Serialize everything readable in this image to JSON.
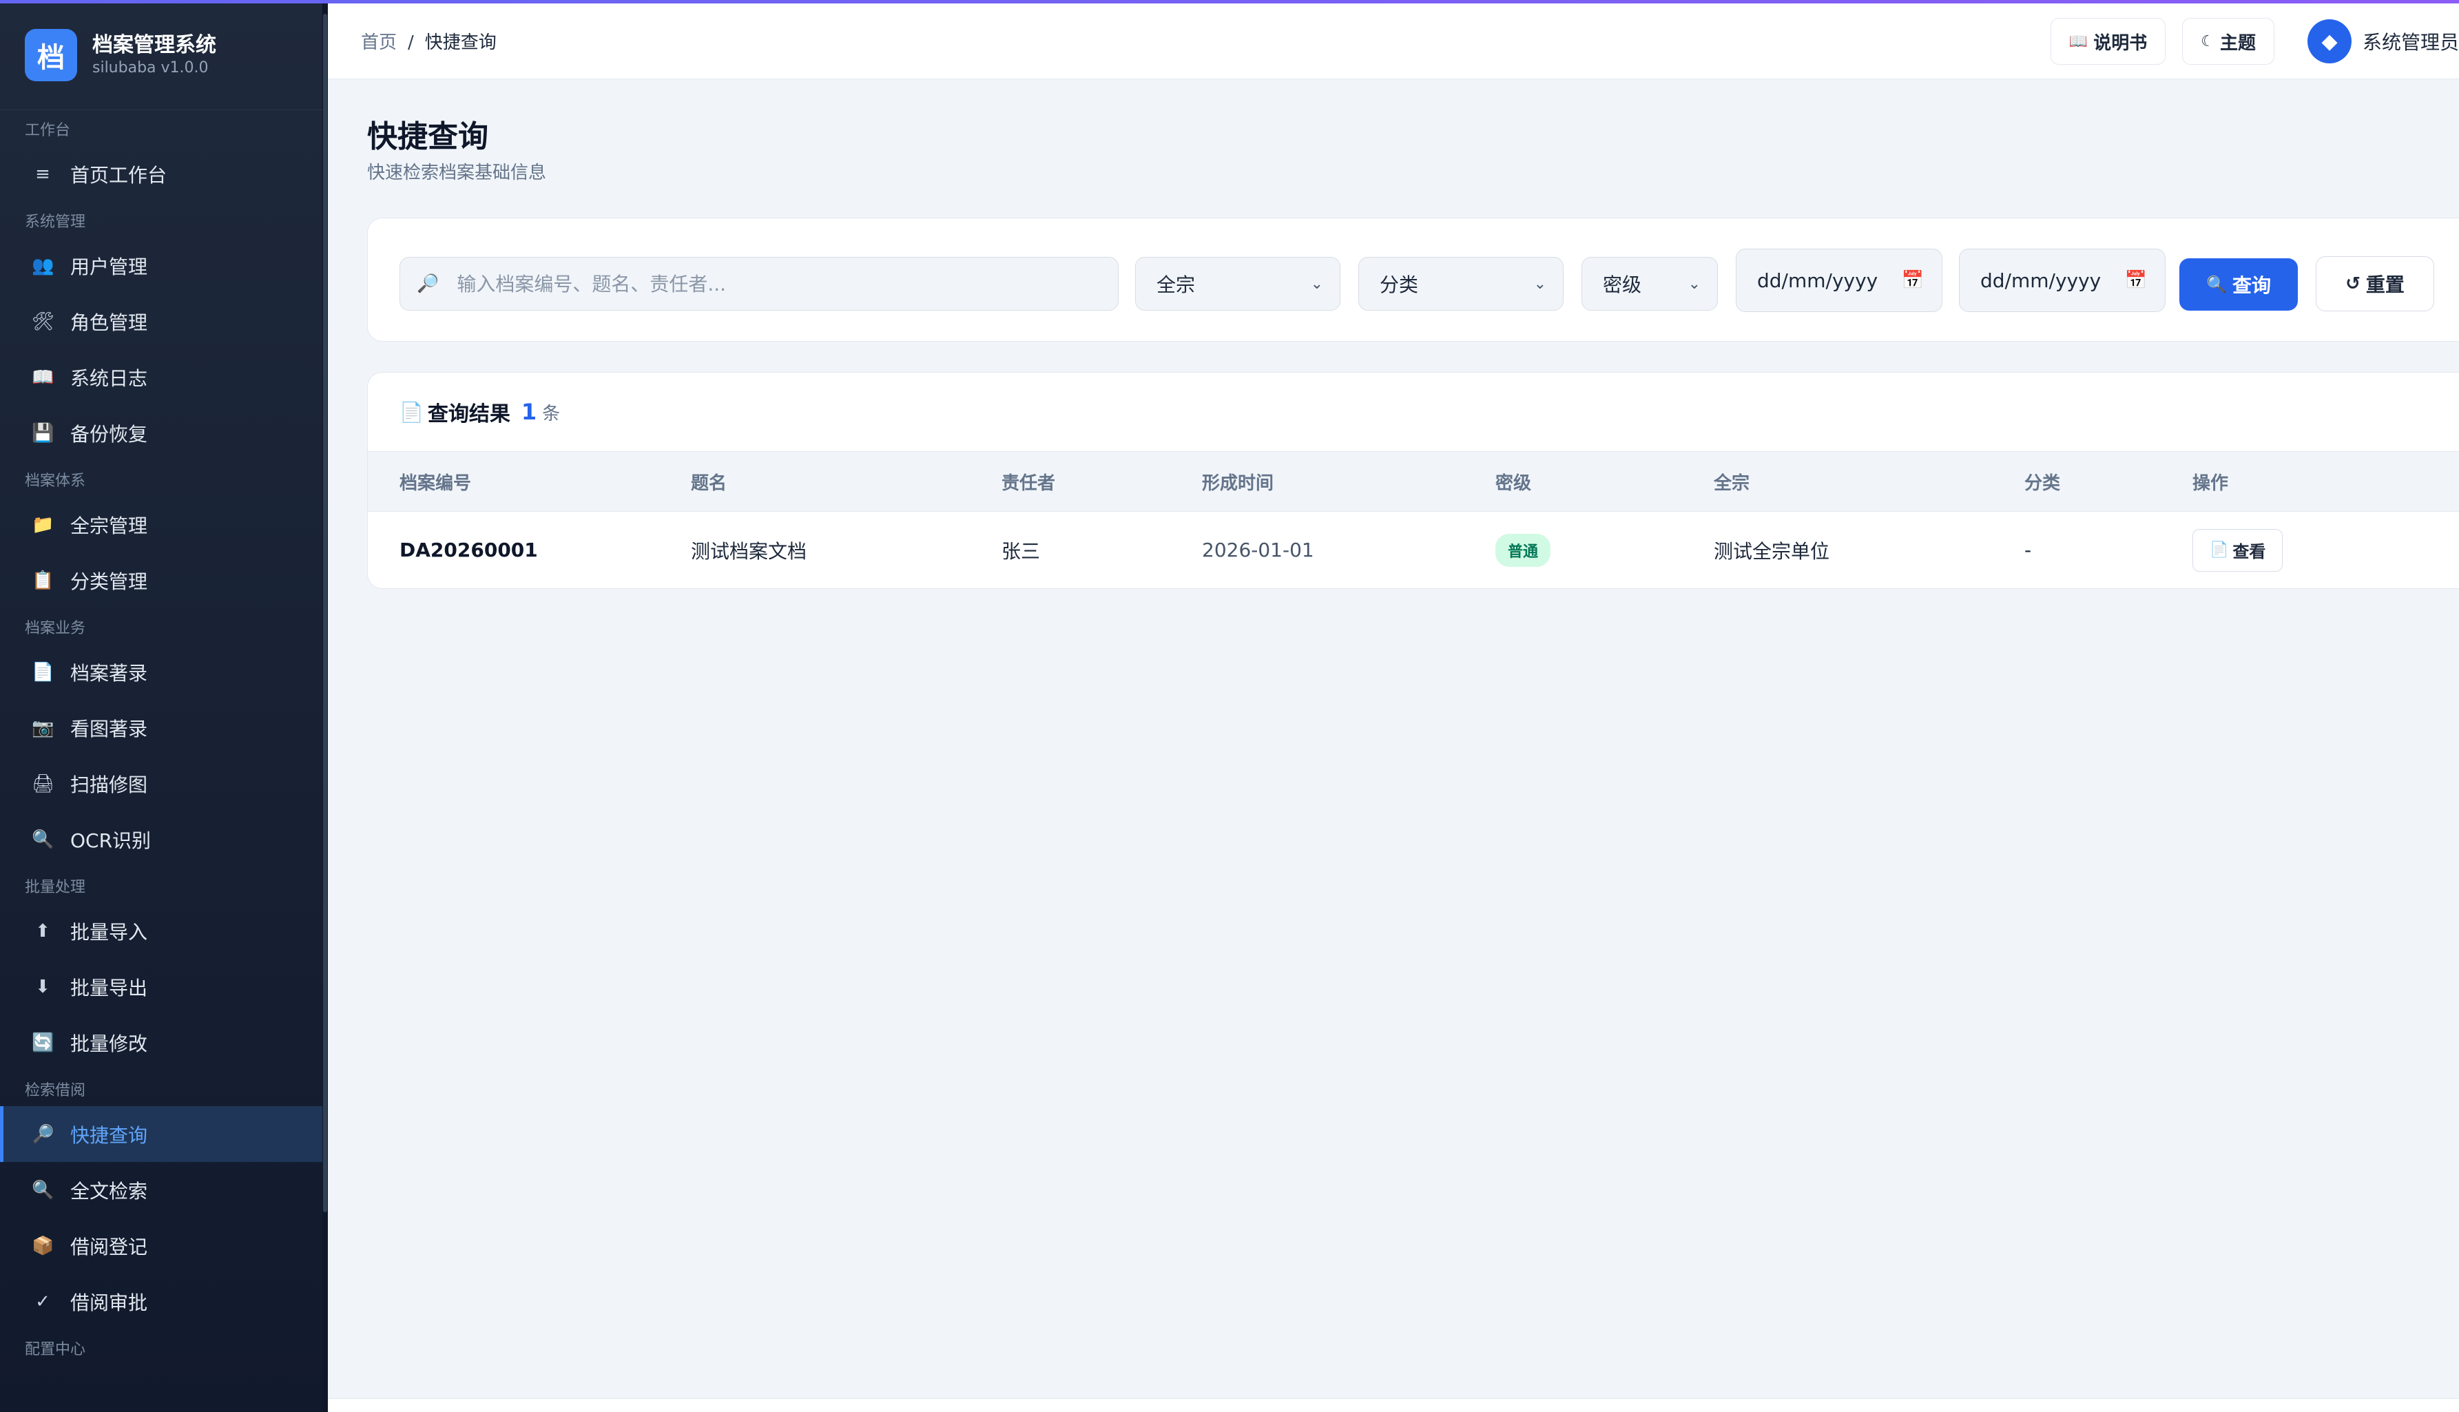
{
  "app": {
    "logo_char": "档",
    "title": "档案管理系统",
    "version": "silubaba v1.0.0"
  },
  "sidebar": {
    "groups": [
      {
        "label": "工作台",
        "items": [
          {
            "icon": "≡",
            "label": "首页工作台"
          }
        ]
      },
      {
        "label": "系统管理",
        "items": [
          {
            "icon": "👥",
            "label": "用户管理"
          },
          {
            "icon": "🛠",
            "label": "角色管理"
          },
          {
            "icon": "📖",
            "label": "系统日志"
          },
          {
            "icon": "💾",
            "label": "备份恢复"
          }
        ]
      },
      {
        "label": "档案体系",
        "items": [
          {
            "icon": "📁",
            "label": "全宗管理"
          },
          {
            "icon": "📋",
            "label": "分类管理"
          }
        ]
      },
      {
        "label": "档案业务",
        "items": [
          {
            "icon": "📄",
            "label": "档案著录"
          },
          {
            "icon": "📷",
            "label": "看图著录"
          },
          {
            "icon": "🖨",
            "label": "扫描修图"
          },
          {
            "icon": "🔍",
            "label": "OCR识别"
          }
        ]
      },
      {
        "label": "批量处理",
        "items": [
          {
            "icon": "⬆",
            "label": "批量导入"
          },
          {
            "icon": "⬇",
            "label": "批量导出"
          },
          {
            "icon": "🔄",
            "label": "批量修改"
          }
        ]
      },
      {
        "label": "检索借阅",
        "items": [
          {
            "icon": "🔎",
            "label": "快捷查询"
          },
          {
            "icon": "🔍",
            "label": "全文检索"
          },
          {
            "icon": "📦",
            "label": "借阅登记"
          },
          {
            "icon": "✓",
            "label": "借阅审批"
          }
        ]
      },
      {
        "label": "配置中心",
        "items": []
      }
    ]
  },
  "header": {
    "breadcrumb_home": "首页",
    "breadcrumb_sep": "/",
    "breadcrumb_current": "快捷查询",
    "manual_icon": "📖",
    "manual_label": "说明书",
    "theme_icon": "☾",
    "theme_label": "主题",
    "avatar_char": "◆",
    "username": "系统管理员"
  },
  "page": {
    "title": "快捷查询",
    "subtitle": "快速检索档案基础信息"
  },
  "filters": {
    "search_icon": "🔎",
    "search_placeholder": "输入档案编号、题名、责任者...",
    "fonds_value": "全宗",
    "category_value": "分类",
    "secret_value": "密级",
    "date_from": "dd/mm/yyyy",
    "date_to": "dd/mm/yyyy",
    "calendar_icon": "📅",
    "chevron": "⌄",
    "query_icon": "🔍",
    "query_label": "查询",
    "reset_icon": "↺",
    "reset_label": "重置"
  },
  "results": {
    "icon": "📄",
    "title": "查询结果",
    "count": "1",
    "unit": "条",
    "columns": [
      "档案编号",
      "题名",
      "责任者",
      "形成时间",
      "密级",
      "全宗",
      "分类",
      "操作"
    ],
    "rows": [
      {
        "code": "DA20260001",
        "title": "测试档案文档",
        "author": "张三",
        "date": "2026-01-01",
        "secret": "普通",
        "fonds": "测试全宗单位",
        "category": "-",
        "action_icon": "📄",
        "action_label": "查看"
      }
    ]
  },
  "colors": {
    "accent": "#2563eb",
    "sidebar_bg": "#1e293b",
    "badge_bg": "#d1fae5",
    "badge_text": "#047857"
  }
}
